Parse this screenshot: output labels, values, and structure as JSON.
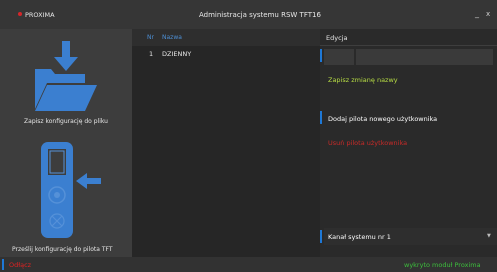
{
  "titlebar": {
    "brand": "PROXIMA",
    "title": "Administracja systemu RSW TFT16",
    "minimize": "_",
    "close": "x"
  },
  "left_panel": {
    "save_tile": {
      "label": "Zapisz konfigurację do pliku",
      "icon": "folder-download-icon"
    },
    "send_tile": {
      "label": "Prześlij konfigurację do pilota TFT",
      "icon": "remote-send-icon"
    }
  },
  "list": {
    "headers": {
      "nr": "Nr",
      "name": "Nazwa"
    },
    "rows": [
      {
        "nr": "1",
        "name": "DZIENNY"
      }
    ]
  },
  "edit": {
    "header": "Edycja",
    "name_value": "",
    "rename_action": "Zapisz zmianę nazwy",
    "add_remote_action": "Dodaj pilota nowego użytkownika",
    "delete_remote_action": "Usuń pilota użytkownika",
    "channel_select": "Kanał systemu nr 1"
  },
  "status": {
    "left": "Odłącz",
    "right": "wykryto moduł Proxima"
  },
  "colors": {
    "accent_blue": "#1e78d6",
    "header_blue": "#4d8fd4",
    "rename_green": "#b7dd44",
    "delete_red": "#c92a28",
    "status_red": "#e02222",
    "status_green": "#3cbf3c",
    "icon_blue": "#3b7fd0"
  }
}
